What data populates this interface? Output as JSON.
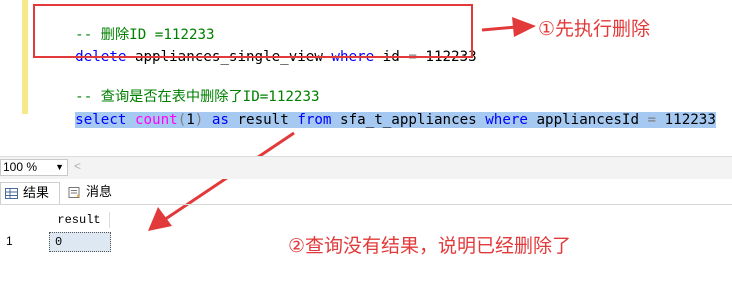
{
  "editor": {
    "line1_comment": "-- 删除ID =112233",
    "line2": {
      "kw1": "delete",
      "t1": " appliances_single_view ",
      "kw2": "where",
      "t2": " id ",
      "op": "=",
      "t3": " 112233"
    },
    "line3_comment": "-- 查询是否在表中删除了ID=112233",
    "line4": {
      "kw1": "select",
      "t0": " ",
      "fn": "count",
      "op1": "(",
      "num": "1",
      "op2": ")",
      "t1": " ",
      "kw2": "as",
      "t2": " result ",
      "kw3": "from",
      "t3": " sfa_t_appliances ",
      "kw4": "where",
      "t4": " appliancesId ",
      "op3": "=",
      "t5": " 112233"
    }
  },
  "annotations": {
    "step1": "①先执行删除",
    "step2": "②查询没有结果，说明已经删除了"
  },
  "toolbar": {
    "zoom": "100 %"
  },
  "tabs": [
    {
      "label": "结果",
      "active": true
    },
    {
      "label": "消息",
      "active": false
    }
  ],
  "results": {
    "columns": [
      "result"
    ],
    "rows": [
      {
        "num": "1",
        "values": [
          "0"
        ]
      }
    ]
  }
}
